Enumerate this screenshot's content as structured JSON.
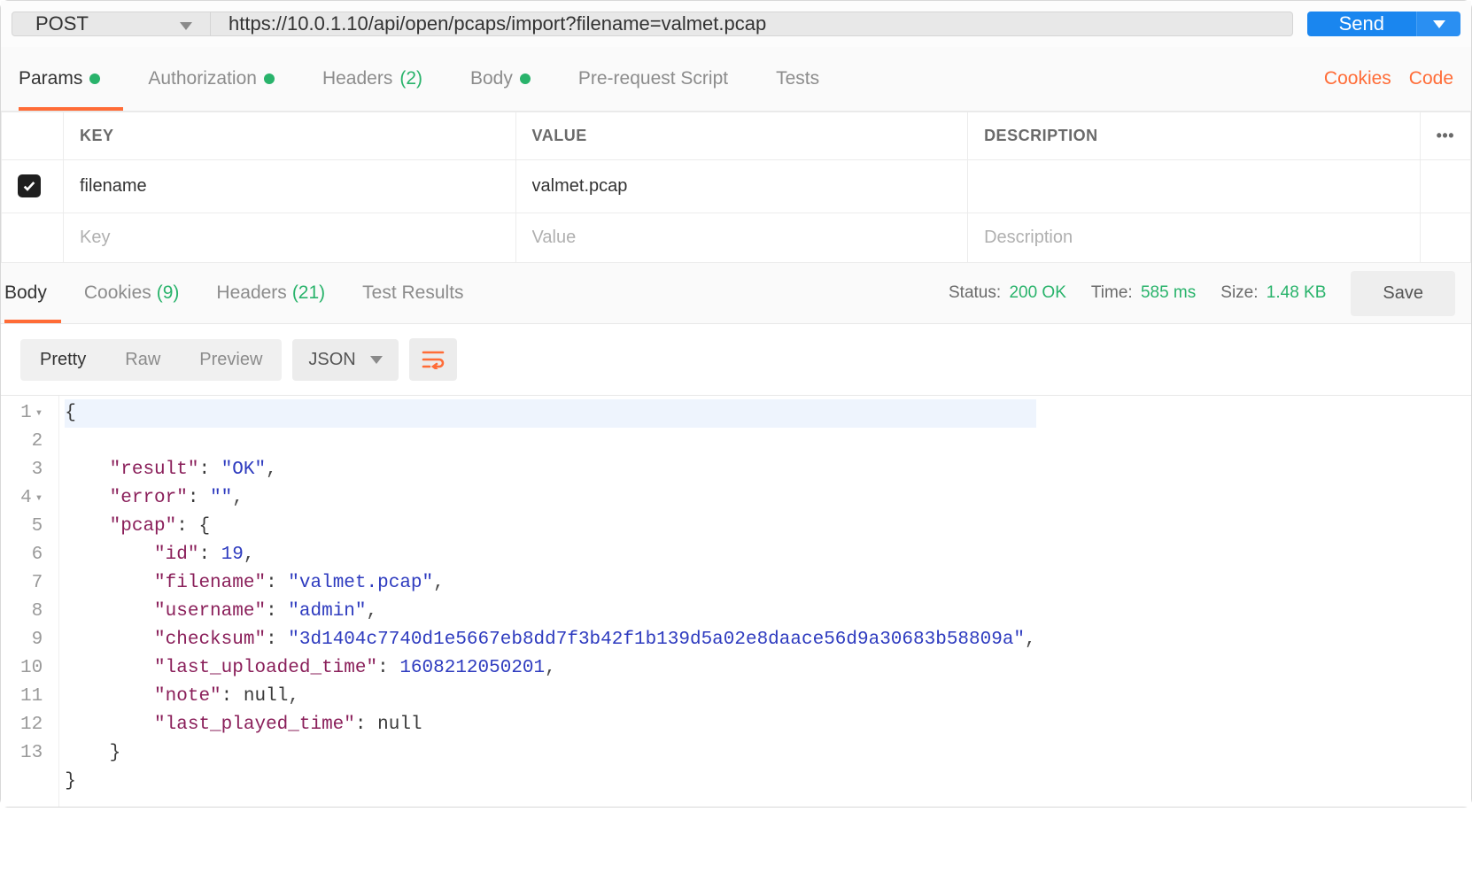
{
  "request": {
    "method": "POST",
    "url": "https://10.0.1.10/api/open/pcaps/import?filename=valmet.pcap",
    "send_label": "Send"
  },
  "req_tabs": {
    "params": "Params",
    "authorization": "Authorization",
    "headers": "Headers",
    "headers_count": "(2)",
    "body": "Body",
    "prerequest": "Pre-request Script",
    "tests": "Tests"
  },
  "right_links": {
    "cookies": "Cookies",
    "code": "Code"
  },
  "params_table": {
    "cols": {
      "key": "KEY",
      "value": "VALUE",
      "desc": "DESCRIPTION"
    },
    "row": {
      "key": "filename",
      "value": "valmet.pcap",
      "desc": ""
    },
    "placeholders": {
      "key": "Key",
      "value": "Value",
      "desc": "Description"
    }
  },
  "resp_tabs": {
    "body": "Body",
    "cookies": "Cookies",
    "cookies_count": "(9)",
    "headers": "Headers",
    "headers_count": "(21)",
    "test_results": "Test Results"
  },
  "resp_meta": {
    "status_label": "Status:",
    "status_value": "200 OK",
    "time_label": "Time:",
    "time_value": "585 ms",
    "size_label": "Size:",
    "size_value": "1.48 KB",
    "save_label": "Save"
  },
  "body_controls": {
    "pretty": "Pretty",
    "raw": "Raw",
    "preview": "Preview",
    "format": "JSON"
  },
  "response_body": {
    "result": "OK",
    "error": "",
    "pcap": {
      "id": 19,
      "filename": "valmet.pcap",
      "username": "admin",
      "checksum": "3d1404c7740d1e5667eb8dd7f3b42f1b139d5a02e8daace56d9a30683b58809a",
      "last_uploaded_time": 1608212050201,
      "note": null,
      "last_played_time": null
    }
  },
  "gutter_lines": [
    "1",
    "2",
    "3",
    "4",
    "5",
    "6",
    "7",
    "8",
    "9",
    "10",
    "11",
    "12",
    "13"
  ]
}
